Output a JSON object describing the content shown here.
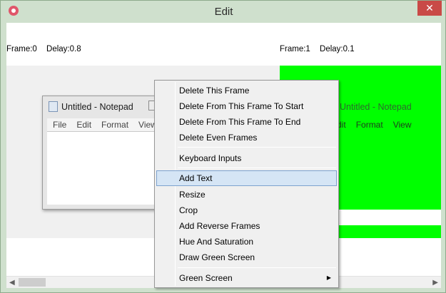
{
  "window": {
    "title": "Edit",
    "close_glyph": "✕"
  },
  "frames": [
    {
      "frame_label": "Frame:0",
      "delay_label": "Delay:0.8"
    },
    {
      "frame_label": "Frame:1",
      "delay_label": "Delay:0.1"
    }
  ],
  "notepad": {
    "title": "Untitled - Notepad",
    "menu": [
      "File",
      "Edit",
      "Format",
      "View"
    ],
    "menu_green": [
      "Edit",
      "Format",
      "View"
    ]
  },
  "context_menu": {
    "items": [
      {
        "label": "Delete This Frame"
      },
      {
        "label": "Delete From This Frame To Start"
      },
      {
        "label": "Delete From This Frame To End"
      },
      {
        "label": "Delete Even Frames"
      },
      {
        "label": "Keyboard Inputs"
      },
      {
        "label": "Add Text",
        "highlighted": true
      },
      {
        "label": "Resize"
      },
      {
        "label": "Crop"
      },
      {
        "label": "Add Reverse Frames"
      },
      {
        "label": "Hue And Saturation"
      },
      {
        "label": "Draw Green Screen"
      },
      {
        "label": "Green Screen",
        "has_submenu": true
      }
    ]
  },
  "scrollbar": {
    "left_arrow": "◀",
    "right_arrow": "▶"
  },
  "colors": {
    "green_screen": "#00ff00",
    "highlight": "#d5e5f5",
    "close_red": "#c94a47"
  }
}
